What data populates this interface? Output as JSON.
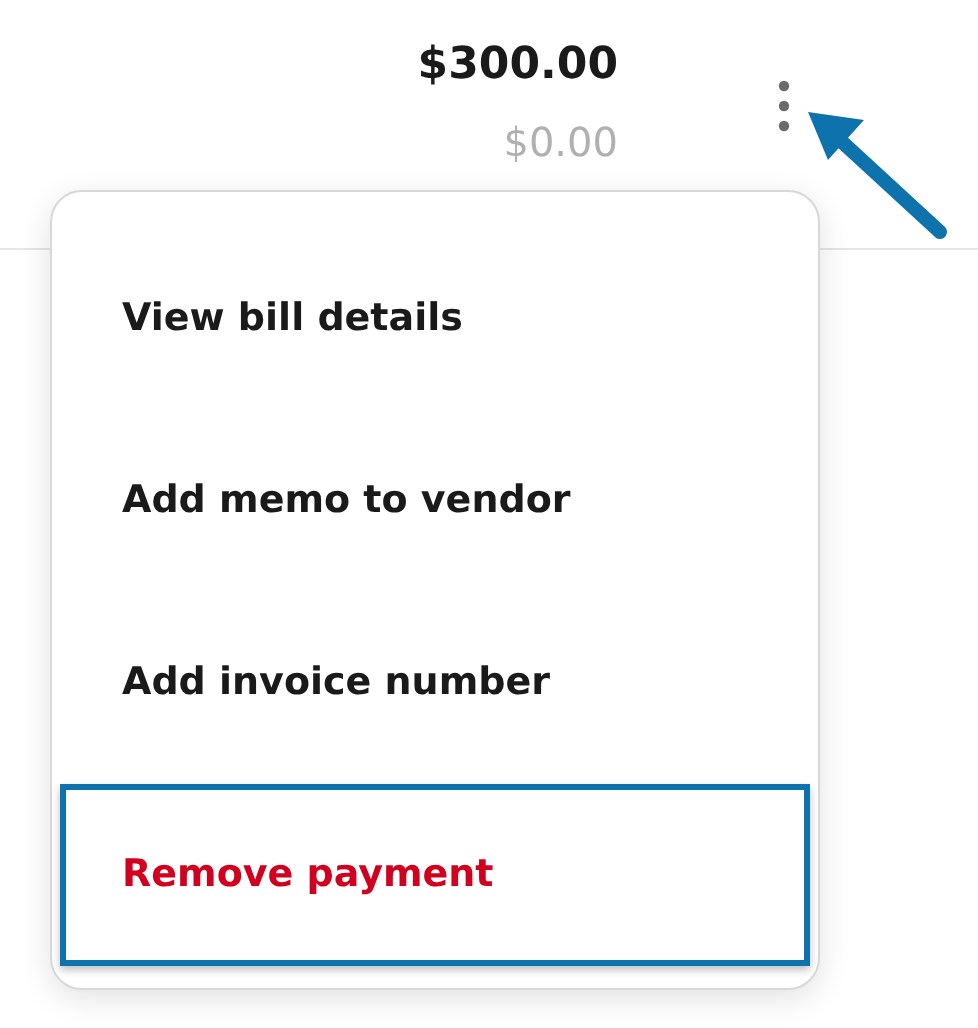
{
  "amounts": {
    "total": "$300.00",
    "paid": "$0.00"
  },
  "menu": {
    "items": [
      {
        "label": "View bill details",
        "kind": "normal",
        "highlighted": false
      },
      {
        "label": "Add memo to vendor",
        "kind": "normal",
        "highlighted": false
      },
      {
        "label": "Add invoice number",
        "kind": "normal",
        "highlighted": false
      },
      {
        "label": "Remove payment",
        "kind": "danger",
        "highlighted": true
      }
    ]
  }
}
